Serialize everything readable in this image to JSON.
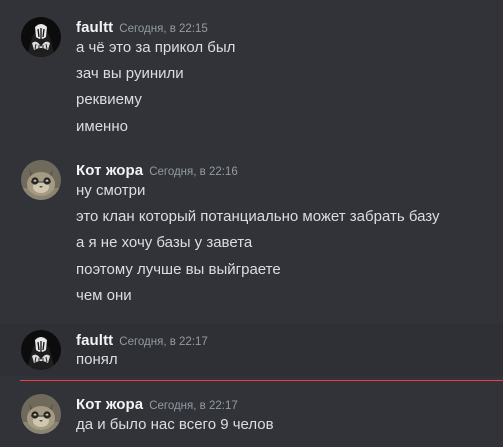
{
  "groups": [
    {
      "username": "faultt",
      "timestamp": "Сегодня, в 22:15",
      "avatar_icon": "dark-portrait-avatar-icon",
      "messages": [
        "а чё это за прикол был",
        "зач вы руинили",
        "реквиему",
        "именно"
      ]
    },
    {
      "username": "Кот жора",
      "timestamp": "Сегодня, в 22:16",
      "avatar_icon": "cat-avatar-icon",
      "messages": [
        "ну смотри",
        "это клан который потанциально может забрать базу",
        "а я не хочу базы у завета",
        "поэтому лучше вы выйграете",
        "чем они"
      ]
    },
    {
      "username": "faultt",
      "timestamp": "Сегодня, в 22:17",
      "avatar_icon": "dark-portrait-avatar-icon",
      "messages": [
        "понял"
      ]
    },
    {
      "username": "Кот жора",
      "timestamp": "Сегодня, в 22:17",
      "avatar_icon": "cat-avatar-icon",
      "messages": [
        "да и было нас всего 9 челов"
      ]
    }
  ],
  "colors": {
    "background": "#313338",
    "hover_background": "#2e3035",
    "username": "#f2f3f5",
    "timestamp": "#949ba4",
    "message_text": "#dbdee1",
    "new_messages_divider": "#f23f43"
  }
}
